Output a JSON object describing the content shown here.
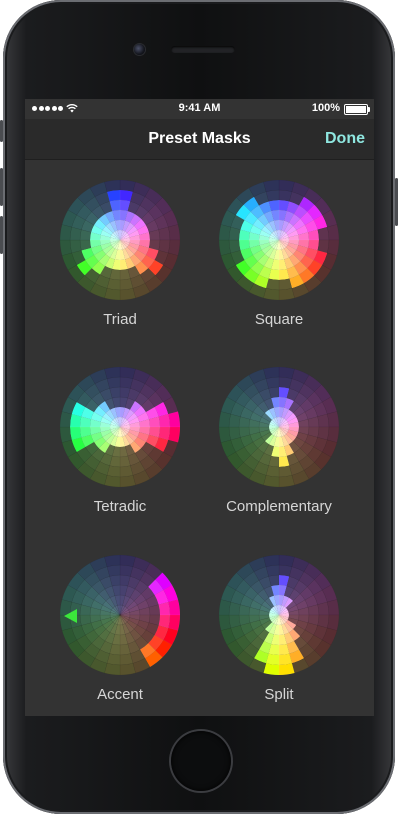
{
  "status_bar": {
    "time": "9:41 AM",
    "battery": "100%"
  },
  "nav": {
    "title": "Preset Masks",
    "done_label": "Done"
  },
  "masks": [
    {
      "label": "Triad"
    },
    {
      "label": "Square"
    },
    {
      "label": "Tetradic"
    },
    {
      "label": "Complementary"
    },
    {
      "label": "Accent"
    },
    {
      "label": "Split"
    }
  ],
  "colors": {
    "accent": "#8fe7e0",
    "screen_bg": "#333333",
    "nav_bg": "#2a2a2a"
  }
}
